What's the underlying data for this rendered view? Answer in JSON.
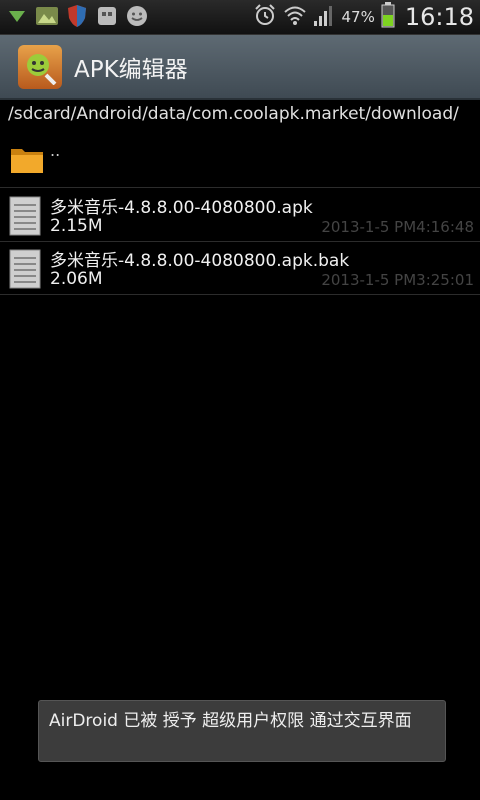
{
  "status_bar": {
    "battery_percent": "47%",
    "time": "16:18",
    "left_icons": [
      "download-icon",
      "photo-icon",
      "shield-icon",
      "notification-icon",
      "smiley-icon"
    ],
    "right_icons": [
      "alarm-icon",
      "wifi-icon",
      "signal-icon",
      "battery-icon"
    ]
  },
  "app": {
    "title": "APK编辑器",
    "icon": "apk-editor-icon"
  },
  "browser": {
    "path": "/sdcard/Android/data/com.coolapk.market/download/",
    "parent_label": "..",
    "files": [
      {
        "name": "多米音乐-4.8.8.00-4080800.apk",
        "size": "2.15M",
        "date": "2013-1-5 PM4:16:48"
      },
      {
        "name": "多米音乐-4.8.8.00-4080800.apk.bak",
        "size": "2.06M",
        "date": "2013-1-5 PM3:25:01"
      }
    ]
  },
  "toast": {
    "message": "AirDroid 已被 授予 超级用户权限 通过交互界面"
  },
  "colors": {
    "background": "#000000",
    "titlebar": "#4d5861",
    "folder": "#f0a020",
    "toast_bg": "#3c3c3c"
  }
}
